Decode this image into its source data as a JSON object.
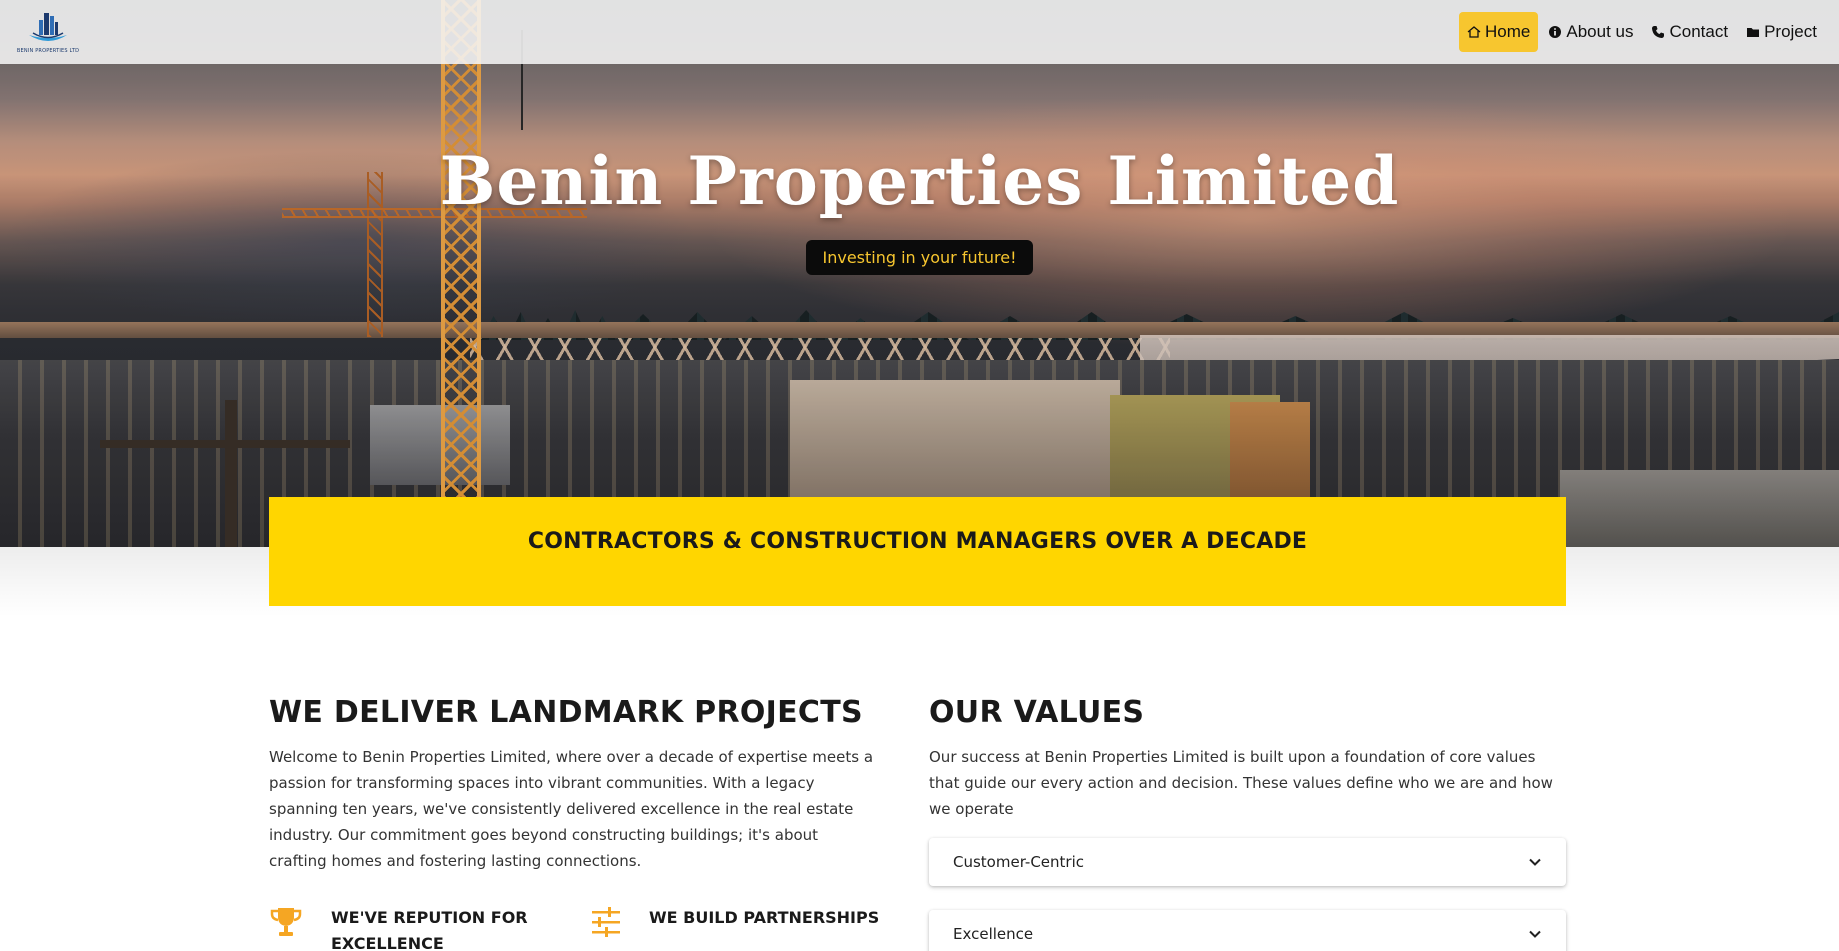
{
  "header": {
    "logo_text": "BENIN PROPERTIES LTD",
    "nav": [
      {
        "label": "Home",
        "icon": "home-icon",
        "active": true
      },
      {
        "label": "About us",
        "icon": "info-icon",
        "active": false
      },
      {
        "label": "Contact",
        "icon": "phone-icon",
        "active": false
      },
      {
        "label": "Project",
        "icon": "folder-icon",
        "active": false
      }
    ]
  },
  "hero": {
    "title": "Benin Properties Limited",
    "tagline": "Investing in your future!"
  },
  "banner": {
    "heading": "CONTRACTORS & CONSTRUCTION MANAGERS OVER A DECADE"
  },
  "deliver": {
    "title": "WE DELIVER LANDMARK PROJECTS",
    "text": "Welcome to Benin Properties Limited, where over a decade of expertise meets a passion for transforming spaces into vibrant communities. With a legacy spanning ten years, we've consistently delivered excellence in the real estate industry. Our commitment goes beyond constructing buildings; it's about crafting homes and fostering lasting connections.",
    "features": [
      {
        "label": "WE'VE REPUTION FOR EXCELLENCE",
        "icon": "trophy-icon"
      },
      {
        "label": "WE BUILD PARTNERSHIPS",
        "icon": "sliders-icon"
      }
    ]
  },
  "values": {
    "title": "OUR VALUES",
    "text": "Our success at Benin Properties Limited is built upon a foundation of core values that guide our every action and decision. These values define who we are and how we operate",
    "items": [
      {
        "label": "Customer-Centric"
      },
      {
        "label": "Excellence"
      }
    ]
  },
  "colors": {
    "accent": "#ffd600",
    "nav_active": "#f7c62f",
    "tagline_bg": "#0b0b0b",
    "tagline_text": "#f7c62f",
    "icon_accent": "#f5a623"
  }
}
